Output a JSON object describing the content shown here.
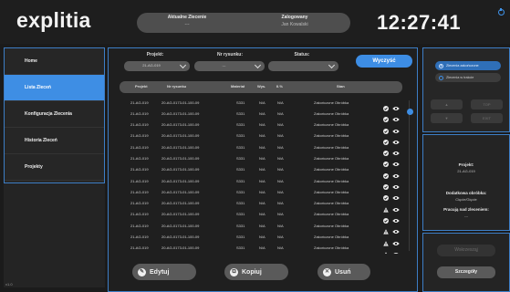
{
  "header": {
    "logo": "explitia",
    "status": {
      "current_order_title": "Aktualne Zlecenie",
      "current_order_value": "---",
      "logged_in_title": "Zalogowany",
      "logged_in_value": "Jan Kowalski"
    },
    "clock": "12:27:41",
    "power_icon": "power-icon"
  },
  "sidebar": {
    "items": [
      {
        "label": "Home",
        "active": false
      },
      {
        "label": "Lista Zleceń",
        "active": true
      },
      {
        "label": "Konfiguracja Zlecenia",
        "active": false
      },
      {
        "label": "Historia Zleceń",
        "active": false
      },
      {
        "label": "Projekty",
        "active": false
      }
    ],
    "version": "v1.0"
  },
  "filters": {
    "project_label": "Projekt:",
    "project_value": "21-AG-019",
    "drawing_label": "Nr rysunku:",
    "drawing_value": "---",
    "status_label": "Status:",
    "status_value": "",
    "clear_button": "Wyczyść"
  },
  "table": {
    "headers": [
      "Projekt",
      "Nr rysunku",
      "Materiał",
      "Wys.",
      "Il.%",
      "Stan"
    ],
    "rows": [
      {
        "project": "21-AG-019",
        "drawing": "20-AG-0173-01-100-09",
        "material": "S331",
        "height": "N/A",
        "qty": "N/A",
        "state": "Zakończone Obróbka",
        "status_icon": "check-icon"
      },
      {
        "project": "21-AG-019",
        "drawing": "20-AG-0173-01-100-09",
        "material": "S331",
        "height": "N/A",
        "qty": "N/A",
        "state": "Zakończone Obróbka",
        "status_icon": "check-icon"
      },
      {
        "project": "21-AG-019",
        "drawing": "20-AG-0173-01-100-09",
        "material": "S331",
        "height": "N/A",
        "qty": "N/A",
        "state": "Zakończone Obróbka",
        "status_icon": "check-icon"
      },
      {
        "project": "21-AG-019",
        "drawing": "20-AG-0173-01-100-09",
        "material": "S331",
        "height": "N/A",
        "qty": "N/A",
        "state": "Zakończone Obróbka",
        "status_icon": "check-icon"
      },
      {
        "project": "21-AG-019",
        "drawing": "20-AG-0173-01-100-09",
        "material": "S331",
        "height": "N/A",
        "qty": "N/A",
        "state": "Zakończone Obróbka",
        "status_icon": "check-icon"
      },
      {
        "project": "21-AG-019",
        "drawing": "20-AG-0173-01-100-09",
        "material": "S331",
        "height": "N/A",
        "qty": "N/A",
        "state": "Zakończone Obróbka",
        "status_icon": "check-icon"
      },
      {
        "project": "21-AG-019",
        "drawing": "20-AG-0173-01-100-09",
        "material": "S331",
        "height": "N/A",
        "qty": "N/A",
        "state": "Zakończone Obróbka",
        "status_icon": "check-icon"
      },
      {
        "project": "21-AG-019",
        "drawing": "20-AG-0173-01-100-09",
        "material": "S331",
        "height": "N/A",
        "qty": "N/A",
        "state": "Zakończone Obróbka",
        "status_icon": "check-icon"
      },
      {
        "project": "21-AG-019",
        "drawing": "20-AG-0173-01-100-09",
        "material": "S331",
        "height": "N/A",
        "qty": "N/A",
        "state": "Zakończone Obróbka",
        "status_icon": "check-icon"
      },
      {
        "project": "21-AG-019",
        "drawing": "20-AG-0173-01-100-09",
        "material": "S331",
        "height": "N/A",
        "qty": "N/A",
        "state": "Zakończone Obróbka",
        "status_icon": "warning-icon"
      },
      {
        "project": "21-AG-019",
        "drawing": "20-AG-0173-01-100-09",
        "material": "S331",
        "height": "N/A",
        "qty": "N/A",
        "state": "Zakończone Obróbka",
        "status_icon": "check-icon"
      },
      {
        "project": "21-AG-019",
        "drawing": "20-AG-0173-01-100-09",
        "material": "S331",
        "height": "N/A",
        "qty": "N/A",
        "state": "Zakończone Obróbka",
        "status_icon": "warning-icon"
      },
      {
        "project": "21-AG-019",
        "drawing": "20-AG-0173-01-100-09",
        "material": "S331",
        "height": "N/A",
        "qty": "N/A",
        "state": "Zakończone Obróbka",
        "status_icon": "warning-icon"
      },
      {
        "project": "21-AG-019",
        "drawing": "20-AG-0173-01-100-09",
        "material": "S331",
        "height": "N/A",
        "qty": "N/A",
        "state": "Zakończone Obróbka",
        "status_icon": "warning-icon"
      }
    ]
  },
  "actions": {
    "edit": "Edytuj",
    "copy": "Kopiuj",
    "delete": "Usuń"
  },
  "right_panel": {
    "radio_options": [
      {
        "label": "Zlecenia zakończone",
        "selected": true
      },
      {
        "label": "Zlecenia w trakcie",
        "selected": false
      }
    ],
    "nav_buttons": {
      "up": "▲",
      "top": "TOP",
      "down": "▼",
      "exit": "EXIT"
    },
    "info": {
      "project_title": "Projekt:",
      "project_value": "21-AG-019",
      "extra_title": "Dodatkowa obróbka:",
      "extra_value": "Cięcie/Gięcie",
      "work_title": "Pracują nad zleceniem:",
      "work_value": "---"
    },
    "load_button": "Wskrzesząj",
    "details_button": "Szczegóły"
  },
  "colors": {
    "accent": "#3e8ee4",
    "background": "#1b1b1b",
    "panel": "#262626",
    "pill": "#5a5a5a"
  }
}
